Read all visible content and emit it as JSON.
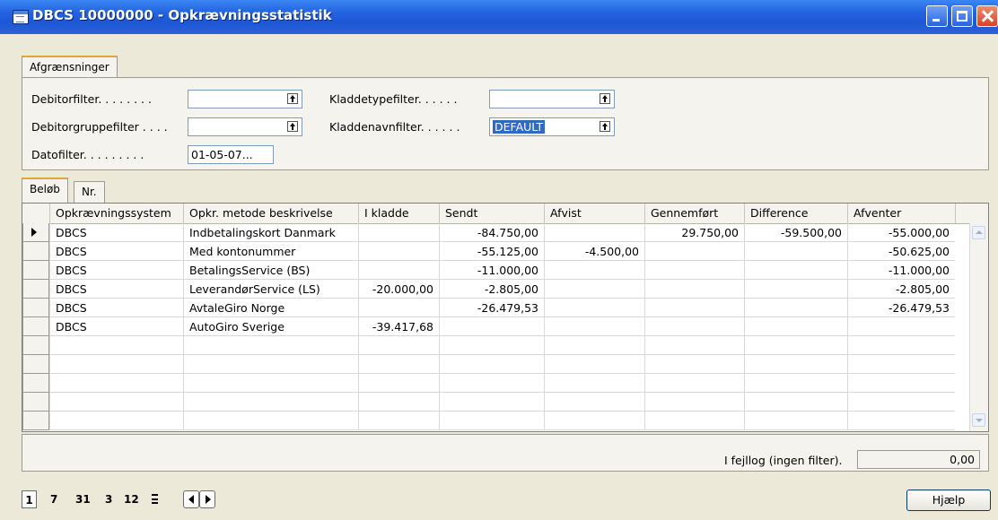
{
  "window": {
    "title": "DBCS 10000000 - Opkrævningsstatistik"
  },
  "filter_tab": {
    "label": "Afgrænsninger"
  },
  "filters": {
    "debitor": {
      "label": "Debitorfilter. . . . . . . .",
      "value": ""
    },
    "debitorgruppe": {
      "label": "Debitorgruppefilter . . . .",
      "value": ""
    },
    "dato": {
      "label": "Datofilter. . . . . . . . .",
      "value": "01-05-07..."
    },
    "kladdetype": {
      "label": "Kladdetypefilter. . . . . .",
      "value": ""
    },
    "kladdenavn": {
      "label": "Kladdenavnfilter. . . . . .",
      "value": "DEFAULT"
    }
  },
  "data_tabs": [
    {
      "label": "Beløb",
      "active": true
    },
    {
      "label": "Nr.",
      "active": false
    }
  ],
  "table": {
    "columns": [
      "Opkrævningssystem",
      "Opkr. metode beskrivelse",
      "I kladde",
      "Sendt",
      "Afvist",
      "Gennemført",
      "Difference",
      "Afventer"
    ],
    "rows": [
      [
        "DBCS",
        "Indbetalingskort Danmark",
        "",
        "-84.750,00",
        "",
        "29.750,00",
        "-59.500,00",
        "-55.000,00"
      ],
      [
        "DBCS",
        "Med kontonummer",
        "",
        "-55.125,00",
        "-4.500,00",
        "",
        "",
        "-50.625,00"
      ],
      [
        "DBCS",
        "BetalingsService (BS)",
        "",
        "-11.000,00",
        "",
        "",
        "",
        "-11.000,00"
      ],
      [
        "DBCS",
        "LeverandørService (LS)",
        "-20.000,00",
        "-2.805,00",
        "",
        "",
        "",
        "-2.805,00"
      ],
      [
        "DBCS",
        "AvtaleGiro Norge",
        "",
        "-26.479,53",
        "",
        "",
        "",
        "-26.479,53"
      ],
      [
        "DBCS",
        "AutoGiro Sverige",
        "-39.417,68",
        "",
        "",
        "",
        "",
        ""
      ],
      [
        "",
        "",
        "",
        "",
        "",
        "",
        "",
        ""
      ],
      [
        "",
        "",
        "",
        "",
        "",
        "",
        "",
        ""
      ],
      [
        "",
        "",
        "",
        "",
        "",
        "",
        "",
        ""
      ],
      [
        "",
        "",
        "",
        "",
        "",
        "",
        "",
        ""
      ],
      [
        "",
        "",
        "",
        "",
        "",
        "",
        "",
        ""
      ]
    ]
  },
  "errorlog": {
    "label": "I fejllog (ingen filter).",
    "value": "0,00"
  },
  "periods": [
    "1",
    "7",
    "31",
    "3",
    "12"
  ],
  "help_button": "Hjælp",
  "icons": [
    "table-icon",
    "minimize-icon",
    "maximize-icon",
    "close-icon",
    "lookup-icon",
    "row-pointer-icon",
    "scroll-up-icon",
    "scroll-down-icon",
    "period-list-icon",
    "previous-icon",
    "next-icon"
  ]
}
